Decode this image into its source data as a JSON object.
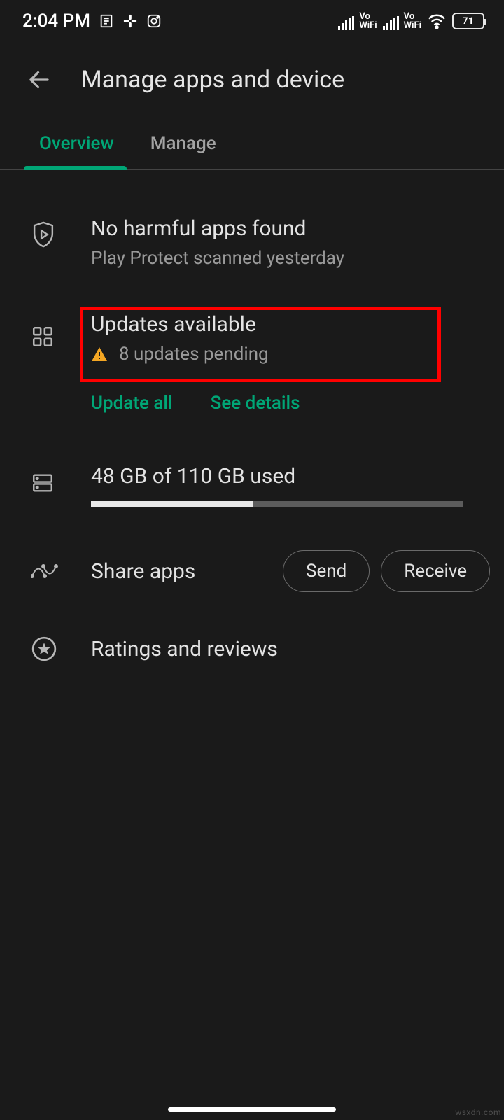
{
  "status": {
    "time": "2:04 PM",
    "battery": "71"
  },
  "header": {
    "title": "Manage apps and device"
  },
  "tabs": [
    {
      "label": "Overview",
      "active": true
    },
    {
      "label": "Manage",
      "active": false
    }
  ],
  "protect": {
    "title": "No harmful apps found",
    "sub": "Play Protect scanned yesterday"
  },
  "updates": {
    "title": "Updates available",
    "sub": "8 updates pending",
    "update_all_label": "Update all",
    "see_details_label": "See details"
  },
  "storage": {
    "title": "48 GB of 110 GB used",
    "fill_percent": 43.6
  },
  "share": {
    "label": "Share apps",
    "send_label": "Send",
    "receive_label": "Receive"
  },
  "ratings": {
    "label": "Ratings and reviews"
  },
  "watermark": "wsxdn.com"
}
